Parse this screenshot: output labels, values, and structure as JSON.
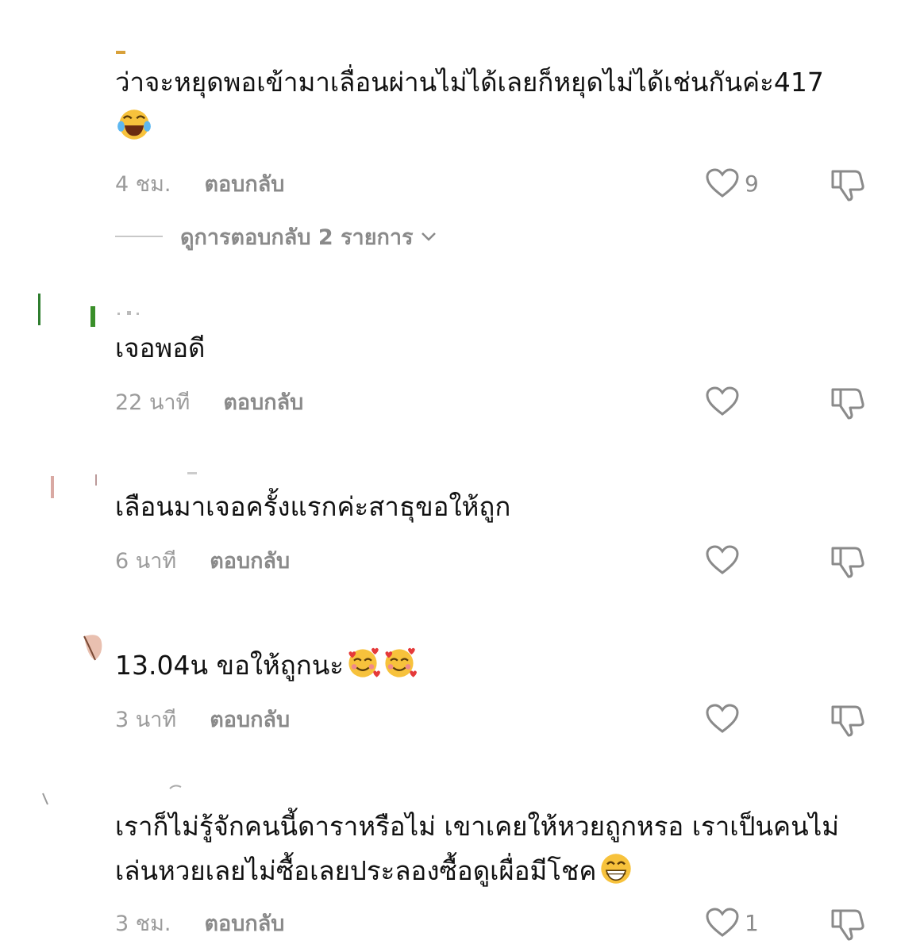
{
  "comments": [
    {
      "text": "ว่าจะหยุดพอเข้ามาเลื่อนผ่านไม่ได้เลยก็หยุดไม่ได้เช่นกันค่ะ417",
      "time": "4 ชม.",
      "reply": "ตอบกลับ",
      "likes": "9",
      "view_replies": "ดูการตอบกลับ 2 รายการ",
      "emoji": "laughing-crying-face-emoji"
    },
    {
      "text": "เจอพอดี",
      "time": "22 นาที",
      "reply": "ตอบกลับ",
      "likes": ""
    },
    {
      "text": "เลือนมาเจอครั้งแรกค่ะสาธุขอให้ถูก",
      "time": "6 นาที",
      "reply": "ตอบกลับ",
      "likes": ""
    },
    {
      "text": "13.04น ขอให้ถูกนะ",
      "time": "3 นาที",
      "reply": "ตอบกลับ",
      "likes": "",
      "emoji": "smiling-face-with-hearts-emoji"
    },
    {
      "text": "เราก็ไม่รู้จักคนนี้ดาราหรือไม่ เขาเคยให้หวยถูกหรอ เราเป็นคนไม่เล่นหวยเลยไม่ซื้อเลยประลองซื้อดูเผื่อมีโชค",
      "time": "3 ชม.",
      "reply": "ตอบกลับ",
      "likes": "1",
      "emoji": "grinning-face-emoji"
    }
  ],
  "colors": {
    "text": "#111111",
    "meta": "#9b9b9b",
    "icon": "#8a8a8a"
  },
  "icons": [
    "heart-outline-icon",
    "thumbs-down-icon",
    "chevron-down-icon"
  ]
}
